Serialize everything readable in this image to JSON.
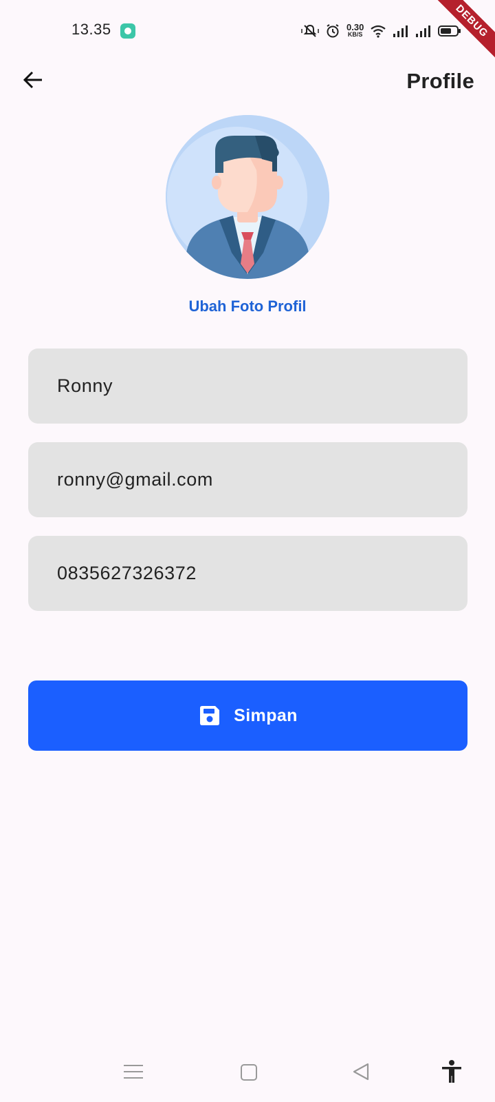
{
  "status_bar": {
    "time": "13.35",
    "net_speed_value": "0.30",
    "net_speed_unit": "KB/S",
    "debug_label": "DEBUG"
  },
  "app_bar": {
    "title": "Profile",
    "back_icon": "arrow-back-icon"
  },
  "profile": {
    "avatar_icon": "businessman-avatar",
    "change_photo_label": "Ubah Foto Profil"
  },
  "form": {
    "name_value": "Ronny",
    "email_value": "ronny@gmail.com",
    "phone_value": "0835627326372"
  },
  "save_button": {
    "label": "Simpan",
    "icon": "save-icon"
  },
  "nav_bar": {
    "items": [
      "menu-icon",
      "home-icon",
      "back-icon",
      "accessibility-icon"
    ]
  },
  "colors": {
    "background": "#fdf8fc",
    "accent": "#1b5fff",
    "link": "#1f63d6",
    "field_bg": "#e3e3e3"
  }
}
